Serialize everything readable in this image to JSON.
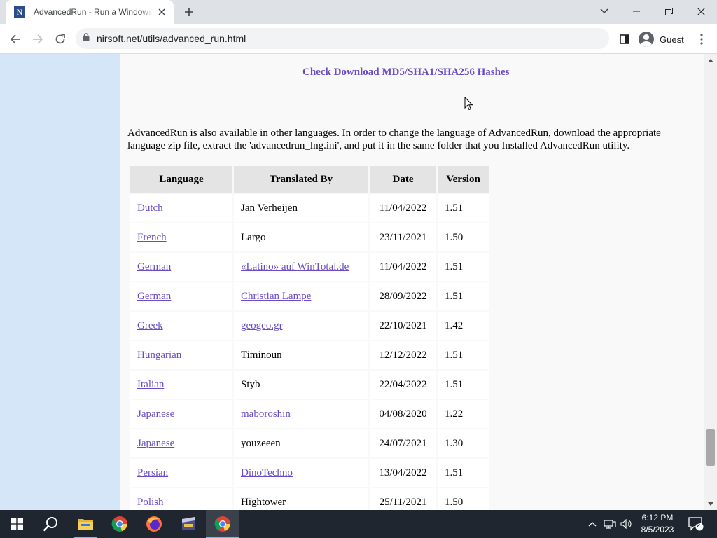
{
  "browser": {
    "tab_title": "AdvancedRun - Run a Windows program with different settings",
    "favicon_letter": "N",
    "url": "nirsoft.net/utils/advanced_run.html",
    "profile_name": "Guest"
  },
  "page": {
    "hash_link": "Check Download MD5/SHA1/SHA256 Hashes",
    "intro": "AdvancedRun is also available in other languages. In order to change the language of AdvancedRun, download the appropriate language zip file, extract the 'advancedrun_lng.ini', and put it in the same folder that you Installed AdvancedRun utility.",
    "table": {
      "headers": [
        "Language",
        "Translated By",
        "Date",
        "Version"
      ],
      "rows": [
        {
          "language": "Dutch",
          "translator": "Jan Verheijen",
          "translator_link": false,
          "date": "11/04/2022",
          "version": "1.51"
        },
        {
          "language": "French",
          "translator": "Largo",
          "translator_link": false,
          "date": "23/11/2021",
          "version": "1.50"
        },
        {
          "language": "German",
          "translator": "«Latino» auf WinTotal.de",
          "translator_link": true,
          "date": "11/04/2022",
          "version": "1.51"
        },
        {
          "language": "German",
          "translator": "Christian Lampe",
          "translator_link": true,
          "date": "28/09/2022",
          "version": "1.51"
        },
        {
          "language": "Greek",
          "translator": "geogeo.gr",
          "translator_link": true,
          "date": "22/10/2021",
          "version": "1.42"
        },
        {
          "language": "Hungarian",
          "translator": "Timinoun",
          "translator_link": false,
          "date": "12/12/2022",
          "version": "1.51"
        },
        {
          "language": "Italian",
          "translator": "Styb",
          "translator_link": false,
          "date": "22/04/2022",
          "version": "1.51"
        },
        {
          "language": "Japanese",
          "translator": "maboroshin",
          "translator_link": true,
          "date": "04/08/2020",
          "version": "1.22"
        },
        {
          "language": "Japanese",
          "translator": "youzeeen",
          "translator_link": false,
          "date": "24/07/2021",
          "version": "1.30"
        },
        {
          "language": "Persian",
          "translator": "DinoTechno",
          "translator_link": true,
          "date": "13/04/2022",
          "version": "1.51"
        },
        {
          "language": "Polish",
          "translator": "Hightower",
          "translator_link": false,
          "date": "25/11/2021",
          "version": "1.50"
        }
      ]
    },
    "scroll_position": 0.92
  },
  "taskbar": {
    "time": "6:12 PM",
    "date": "8/5/2023",
    "notification_count": "2",
    "pinned": [
      "windows-start-icon",
      "search-icon",
      "file-explorer-icon",
      "chrome-icon",
      "firefox-icon",
      "media-app-icon",
      "chrome-active-icon"
    ]
  },
  "colors": {
    "link": "#6a4cc4",
    "sidebar": "#d5e6f9",
    "taskbar": "#1f2630"
  }
}
